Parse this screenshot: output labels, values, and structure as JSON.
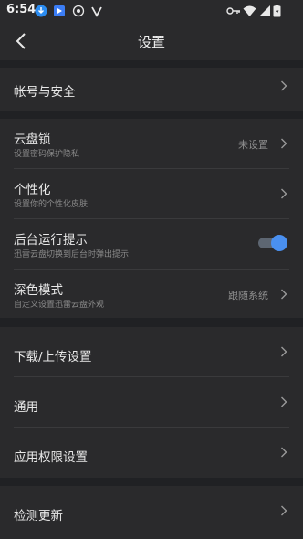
{
  "status_bar": {
    "time": "6:54",
    "left_icons": [
      "download-icon",
      "play-store-icon",
      "shield-icon",
      "v-icon"
    ],
    "right_icons": [
      "key-icon",
      "wifi-icon",
      "signal-icon",
      "battery-icon"
    ]
  },
  "header": {
    "title": "设置"
  },
  "sections": {
    "account": {
      "title": "帐号与安全"
    },
    "cloud_lock": {
      "title": "云盘锁",
      "subtitle": "设置密码保护隐私",
      "value": "未设置"
    },
    "personalize": {
      "title": "个性化",
      "subtitle": "设置你的个性化皮肤"
    },
    "background_hint": {
      "title": "后台运行提示",
      "subtitle": "迅雷云盘切换到后台时弹出提示",
      "enabled": true
    },
    "dark_mode": {
      "title": "深色模式",
      "subtitle": "自定义设置迅雷云盘外观",
      "value": "跟随系统"
    },
    "transfer": {
      "title": "下载/上传设置"
    },
    "general": {
      "title": "通用"
    },
    "permissions": {
      "title": "应用权限设置"
    },
    "update": {
      "title": "检测更新"
    }
  },
  "colors": {
    "accent": "#4a90f0",
    "background": "#202124",
    "surface": "#2a2a2c"
  }
}
